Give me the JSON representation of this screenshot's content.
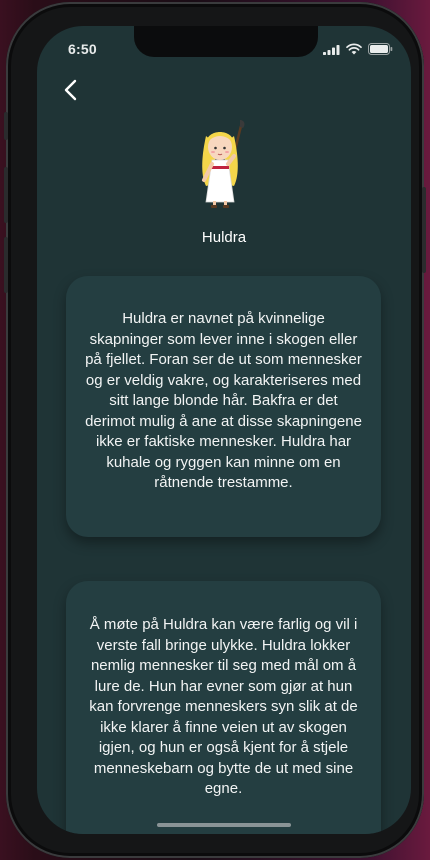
{
  "status_bar": {
    "time": "6:50",
    "icons": [
      "signal-icon",
      "wifi-icon",
      "battery-icon"
    ]
  },
  "nav": {
    "back_icon": "chevron-left-icon"
  },
  "character": {
    "name": "Huldra",
    "avatar_icon": "huldra-avatar-icon"
  },
  "cards": [
    {
      "text": "Huldra er navnet på kvinnelige skapninger som lever inne i skogen eller på fjellet. Foran ser de ut som mennesker og er veldig vakre, og karakteriseres med sitt lange blonde hår. Bakfra er det derimot mulig å ane at disse skapningene ikke er faktiske mennesker. Huldra har kuhale og ryggen kan minne om en råtnende trestamme."
    },
    {
      "text": "Å møte på Huldra kan være farlig og vil i verste fall bringe ulykke. Huldra lokker nemlig mennesker til seg med mål om å lure de. Hun har evner som gjør at hun kan forvrenge menneskers syn slik at de ikke klarer å finne veien ut av skogen igjen, og hun er også kjent for å stjele menneskebarn og bytte de ut med sine egne."
    }
  ],
  "colors": {
    "background": "#1f3436",
    "card": "#243e41",
    "text": "#ffffff"
  }
}
